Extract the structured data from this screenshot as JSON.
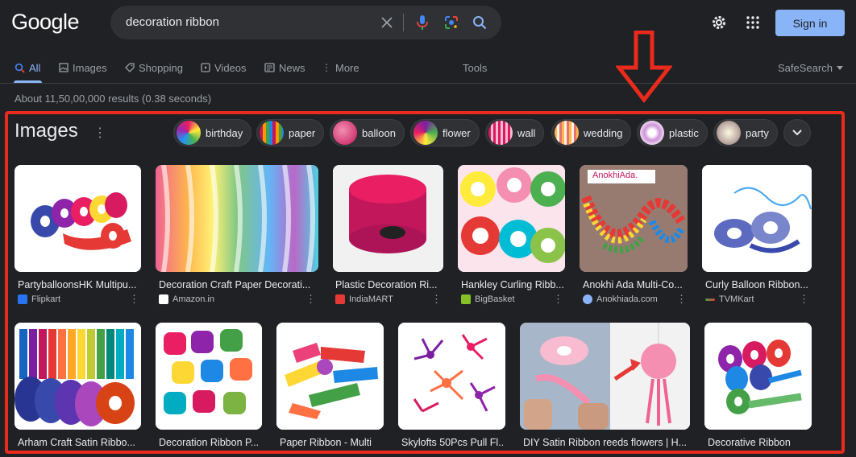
{
  "logo": "Google",
  "search": {
    "query": "decoration ribbon"
  },
  "header": {
    "sign_in": "Sign in"
  },
  "tabs": [
    {
      "label": "All",
      "icon": "search-icon"
    },
    {
      "label": "Images",
      "icon": "image-icon"
    },
    {
      "label": "Shopping",
      "icon": "tag-icon"
    },
    {
      "label": "Videos",
      "icon": "play-icon"
    },
    {
      "label": "News",
      "icon": "newspaper-icon"
    },
    {
      "label": "More",
      "icon": "more-vert-icon"
    }
  ],
  "tools": "Tools",
  "safesearch": "SafeSearch",
  "stats": "About 11,50,00,000 results (0.38 seconds)",
  "images": {
    "title": "Images",
    "chips": [
      "birthday",
      "paper",
      "balloon",
      "flower",
      "wall",
      "wedding",
      "plastic",
      "party"
    ],
    "row1": [
      {
        "title": "PartyballoonsHK Multipu...",
        "source": "Flipkart"
      },
      {
        "title": "Decoration Craft Paper Decorati...",
        "source": "Amazon.in"
      },
      {
        "title": "Plastic Decoration Ri...",
        "source": "IndiaMART"
      },
      {
        "title": "Hankley Curling Ribb...",
        "source": "BigBasket"
      },
      {
        "title": "Anokhi Ada Multi-Co...",
        "source": "Anokhiada.com"
      },
      {
        "title": "Curly Balloon Ribbon...",
        "source": "TVMKart"
      }
    ],
    "row2": [
      {
        "title": "Arham Craft Satin Ribbo..."
      },
      {
        "title": "Decoration Ribbon P..."
      },
      {
        "title": "Paper Ribbon - Multi"
      },
      {
        "title": "Skylofts 50Pcs Pull Fl..."
      },
      {
        "title": "DIY Satin Ribbon reeds flowers | H..."
      },
      {
        "title": "Decorative Ribbon"
      }
    ],
    "image_texts": {
      "anokhi_logo": "AnokhiAda."
    }
  },
  "colors": {
    "accent": "#8ab4f8",
    "annotation": "#ea2a1c",
    "background": "#202124"
  }
}
